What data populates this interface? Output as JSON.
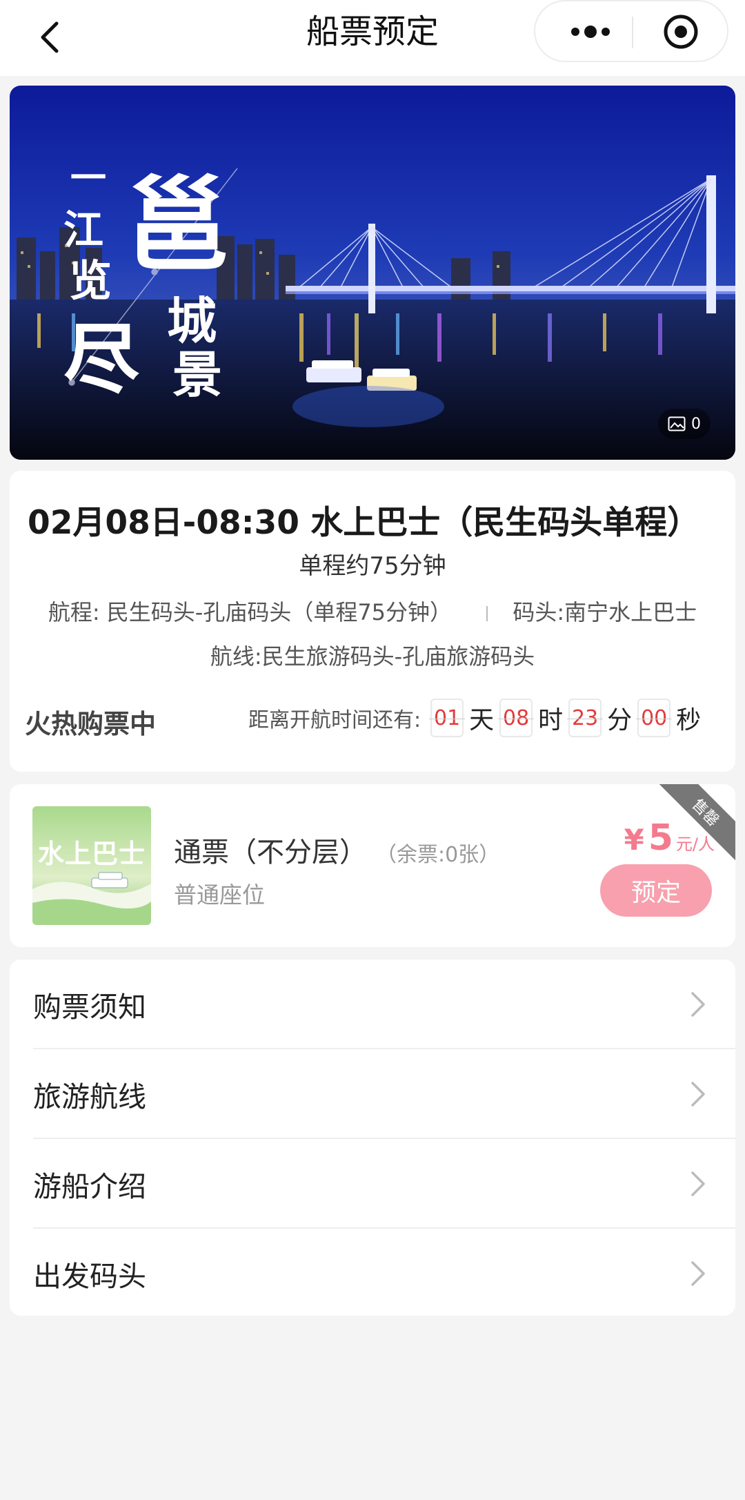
{
  "nav": {
    "title": "船票预定"
  },
  "banner": {
    "photo_count": "0",
    "calligraphy_lines": [
      "一",
      "江",
      "览",
      "尽",
      "邕",
      "城",
      "景"
    ]
  },
  "trip": {
    "title": "02月08日-08:30 水上巴士（民生码头单程）",
    "duration": "单程约75分钟",
    "route": "航程: 民生码头-孔庙码头（单程75分钟）",
    "pier": "码头:南宁水上巴士",
    "line": "航线:民生旅游码头-孔庙旅游码头",
    "status": "火热购票中",
    "countdown_label": "距离开航时间还有:",
    "countdown": {
      "days": "01",
      "days_unit": "天",
      "hours": "08",
      "hours_unit": "时",
      "minutes": "23",
      "minutes_unit": "分",
      "seconds": "00",
      "seconds_unit": "秒"
    }
  },
  "ticket": {
    "thumb_text": "水上巴士",
    "name": "通票（不分层）",
    "remaining": "（余票:0张）",
    "seat": "普通座位",
    "price_symbol": "¥",
    "price": "5",
    "price_unit": "元/人",
    "book_label": "预定",
    "ribbon": "售罄"
  },
  "menu": {
    "items": [
      {
        "label": "购票须知"
      },
      {
        "label": "旅游航线"
      },
      {
        "label": "游船介绍"
      },
      {
        "label": "出发码头"
      }
    ]
  },
  "colors": {
    "accent": "#f47a8e",
    "button": "#f8a0ad",
    "countdown_digit": "#e23a3a"
  }
}
